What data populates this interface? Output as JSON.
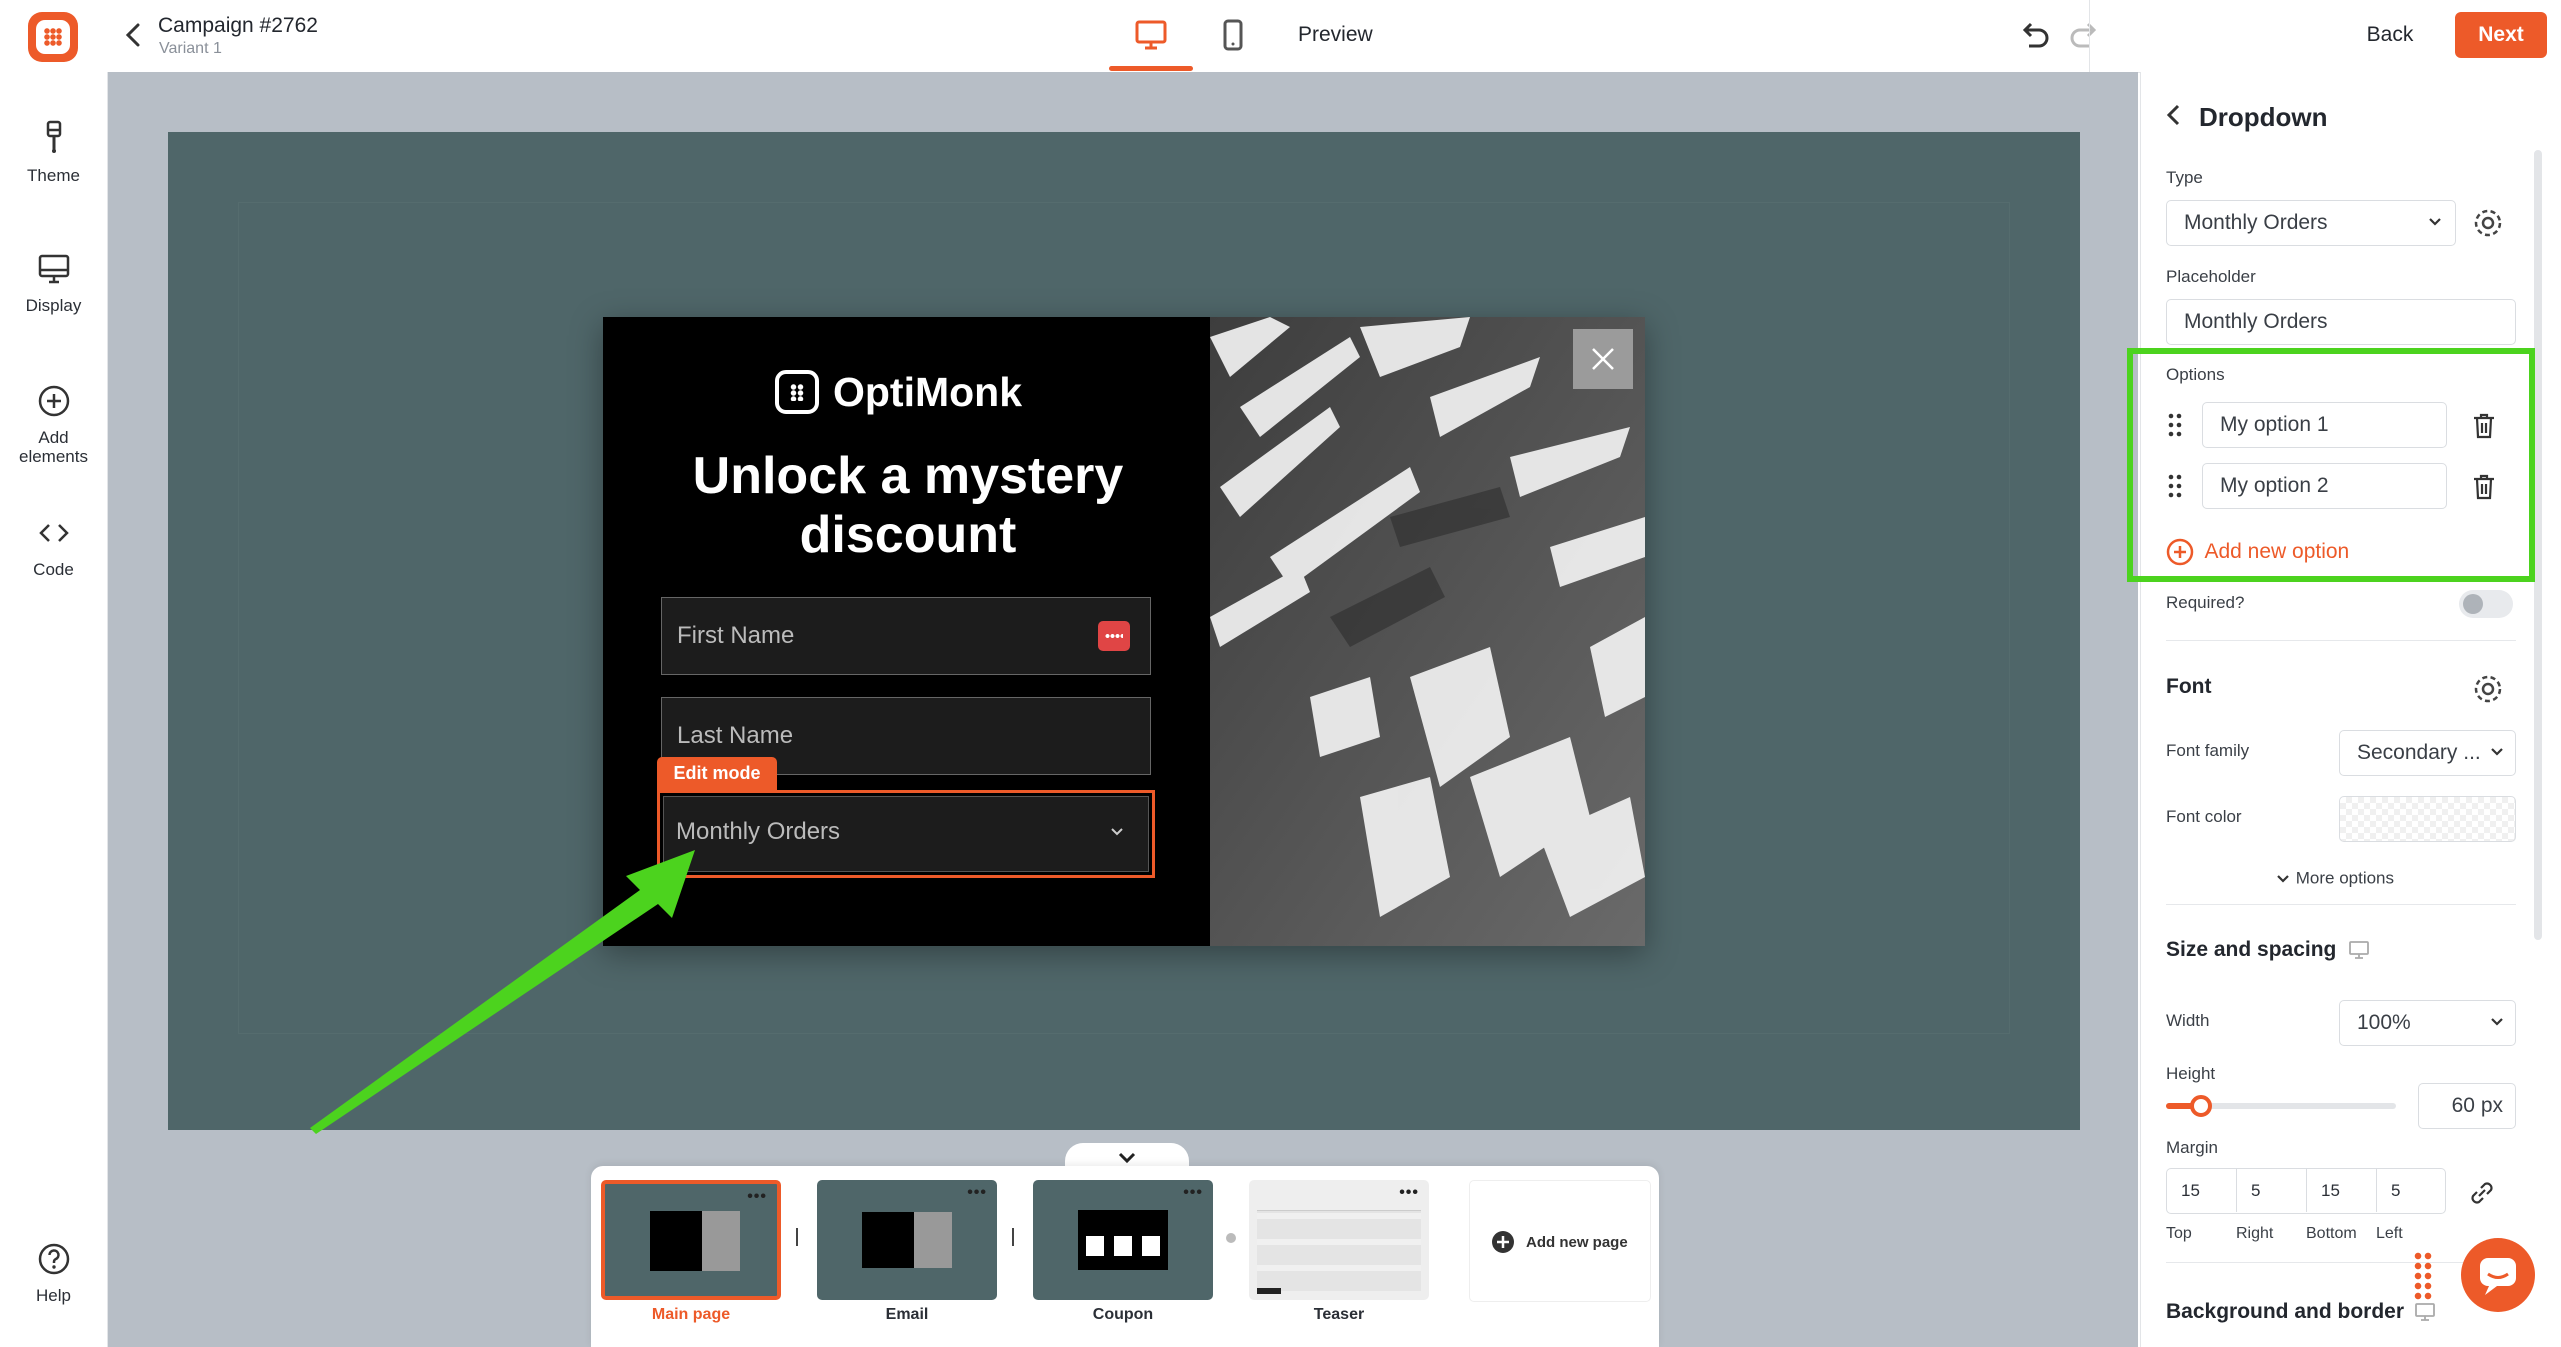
{
  "header": {
    "campaign_title": "Campaign #2762",
    "variant": "Variant 1",
    "preview_label": "Preview",
    "back_label": "Back",
    "next_label": "Next"
  },
  "sidebar": {
    "items": [
      {
        "label": "Theme",
        "icon": "brush-icon"
      },
      {
        "label": "Display",
        "icon": "monitor-icon"
      },
      {
        "label": "Add\nelements",
        "icon": "plus-circle-icon"
      },
      {
        "label": "Code",
        "icon": "code-icon"
      }
    ],
    "help_label": "Help"
  },
  "popup": {
    "brand": "OptiMonk",
    "headline": "Unlock a mystery discount",
    "first_name_placeholder": "First Name",
    "last_name_placeholder": "Last Name",
    "edit_mode_label": "Edit mode",
    "dropdown_value": "Monthly Orders"
  },
  "pages": {
    "items": [
      {
        "label": "Main page",
        "selected": true
      },
      {
        "label": "Email",
        "selected": false
      },
      {
        "label": "Coupon",
        "selected": false
      },
      {
        "label": "Teaser",
        "selected": false
      }
    ],
    "add_label": "Add new page"
  },
  "panel": {
    "title": "Dropdown",
    "type_label": "Type",
    "type_value": "Monthly Orders",
    "placeholder_label": "Placeholder",
    "placeholder_value": "Monthly Orders",
    "options_label": "Options",
    "options": [
      "My option 1",
      "My option 2"
    ],
    "add_option_label": "Add new option",
    "required_label": "Required?",
    "required_on": false,
    "font_heading": "Font",
    "font_family_label": "Font family",
    "font_family_value": "Secondary ...",
    "font_color_label": "Font color",
    "more_options_label": "More options",
    "size_heading": "Size and spacing",
    "width_label": "Width",
    "width_value": "100%",
    "height_label": "Height",
    "height_value": "60 px",
    "margin_label": "Margin",
    "margin_values": [
      "15",
      "5",
      "15",
      "5"
    ],
    "margin_sides": [
      "Top",
      "Right",
      "Bottom",
      "Left"
    ],
    "background_heading": "Background and border"
  },
  "colors": {
    "accent": "#ed5a29",
    "highlight": "#4cd31e",
    "stage": "#4f6669"
  }
}
